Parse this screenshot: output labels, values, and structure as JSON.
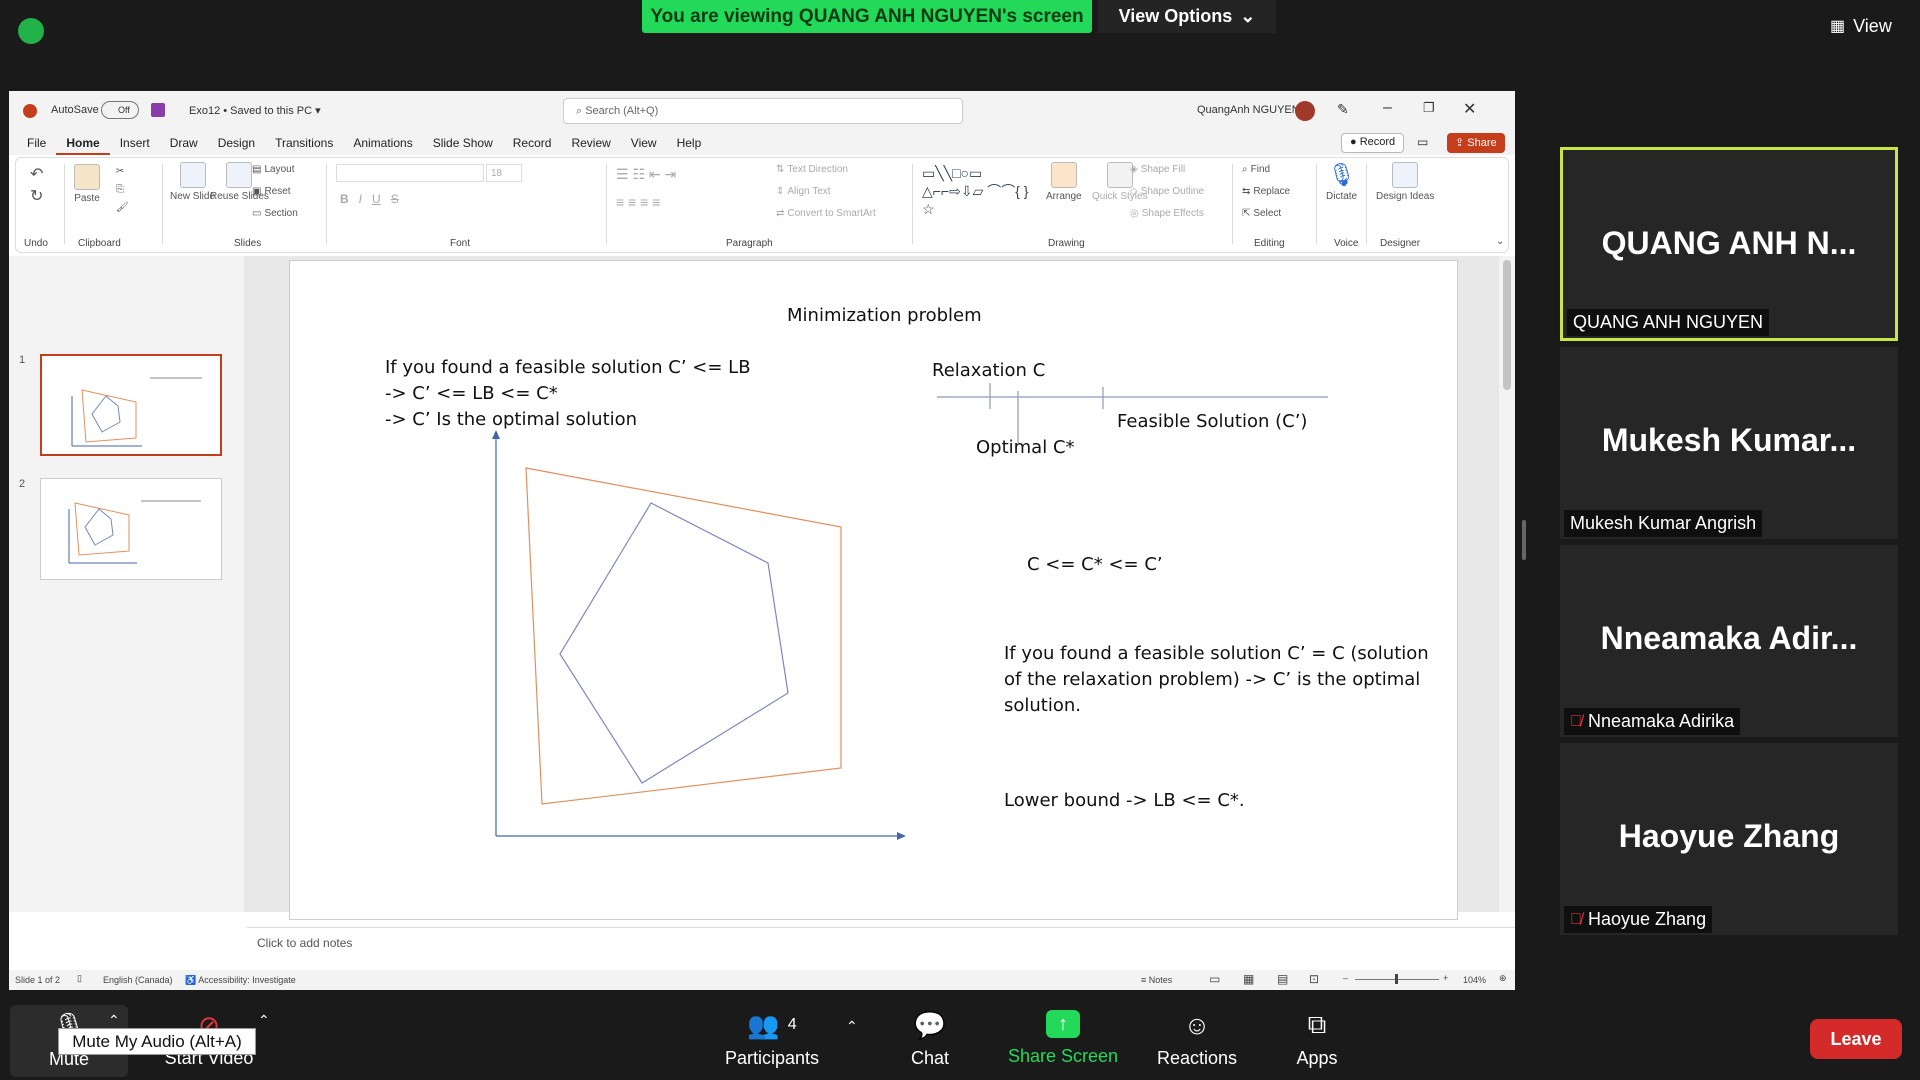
{
  "zoom": {
    "banner": "You are viewing QUANG ANH NGUYEN's screen",
    "view_options": "View Options",
    "view_top": "View"
  },
  "ppt": {
    "autosave": "AutoSave",
    "autosave_state": "Off",
    "doc_title": "Exo12 • Saved to this PC",
    "search_placeholder": "Search (Alt+Q)",
    "user": "QuangAnh NGUYEN",
    "menu": [
      "File",
      "Home",
      "Insert",
      "Draw",
      "Design",
      "Transitions",
      "Animations",
      "Slide Show",
      "Record",
      "Review",
      "View",
      "Help"
    ],
    "record": "Record",
    "share": "Share",
    "ribbon": {
      "undo_label": "Undo",
      "paste": "Paste",
      "clipboard_label": "Clipboard",
      "new_slide": "New Slide",
      "reuse_slides": "Reuse Slides",
      "layout": "Layout",
      "reset": "Reset",
      "section": "Section",
      "slides_label": "Slides",
      "font_label": "Font",
      "font_size": "18",
      "paragraph_label": "Paragraph",
      "text_direction": "Text Direction",
      "align_text": "Align Text",
      "convert_smartart": "Convert to SmartArt",
      "drawing_label": "Drawing",
      "arrange": "Arrange",
      "quick_styles": "Quick Styles",
      "shape_fill": "Shape Fill",
      "shape_outline": "Shape Outline",
      "shape_effects": "Shape Effects",
      "find": "Find",
      "replace": "Replace",
      "select": "Select",
      "editing_label": "Editing",
      "dictate": "Dictate",
      "voice_label": "Voice",
      "design_ideas": "Design Ideas",
      "designer_label": "Designer"
    },
    "thumbs": [
      "1",
      "2"
    ],
    "notes_placeholder": "Click to add notes",
    "status": {
      "slide": "Slide 1 of 2",
      "language": "English (Canada)",
      "accessibility": "Accessibility: Investigate",
      "notes": "Notes",
      "zoom": "104%"
    }
  },
  "slide": {
    "title": "Minimization problem",
    "left_lines": [
      "If you found a feasible solution C’ <= LB",
      "-> C’ <= LB <= C*",
      "-> C’ Is the optimal solution"
    ],
    "relaxation": "Relaxation C",
    "feasible": "Feasible Solution (C’)",
    "optimal": "Optimal C*",
    "inequality": "C <= C* <= C’",
    "right_para": [
      "If you found a feasible solution C’ = C (solution",
      "of the relaxation problem) -> C’ is the optimal",
      "solution."
    ],
    "lower_bound": "Lower bound -> LB <= C*."
  },
  "participants": [
    {
      "display": "QUANG ANH N...",
      "label": "QUANG ANH NGUYEN",
      "muted": false,
      "active": true
    },
    {
      "display": "Mukesh Kumar...",
      "label": "Mukesh Kumar Angrish",
      "muted": false,
      "active": false
    },
    {
      "display": "Nneamaka Adir...",
      "label": "Nneamaka Adirika",
      "muted": true,
      "active": false
    },
    {
      "display": "Haoyue Zhang",
      "label": "Haoyue Zhang",
      "muted": true,
      "active": false
    }
  ],
  "bottom": {
    "mute": "Mute",
    "start_video": "Start Video",
    "participants": "Participants",
    "participants_count": "4",
    "chat": "Chat",
    "share_screen": "Share Screen",
    "reactions": "Reactions",
    "apps": "Apps",
    "leave": "Leave",
    "tooltip": "Mute My Audio (Alt+A)"
  },
  "colors": {
    "zoom_green": "#23d959",
    "ppt_accent": "#c43e1c",
    "leave_red": "#d42a2a",
    "active_speaker": "#c8e64a"
  }
}
